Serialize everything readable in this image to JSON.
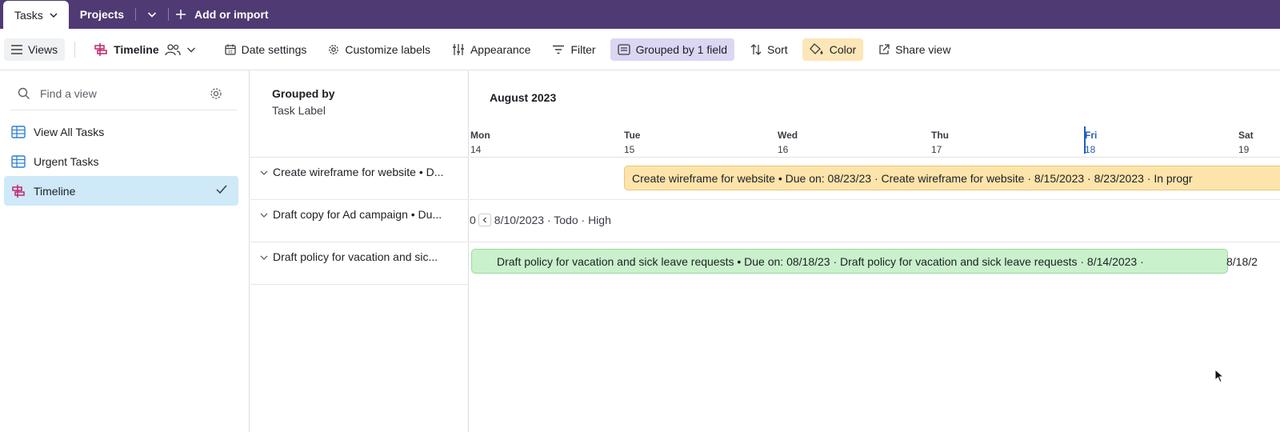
{
  "topbar": {
    "active_tab": "Tasks",
    "tab_projects": "Projects",
    "add_label": "Add or import"
  },
  "toolbar": {
    "views": "Views",
    "timeline": "Timeline",
    "date_settings": "Date settings",
    "customize_labels": "Customize labels",
    "appearance": "Appearance",
    "filter": "Filter",
    "grouped": "Grouped by 1 field",
    "sort": "Sort",
    "color": "Color",
    "share_view": "Share view"
  },
  "sidebar": {
    "search_placeholder": "Find a view",
    "items": [
      {
        "label": "View All Tasks",
        "icon": "grid-icon",
        "selected": false
      },
      {
        "label": "Urgent Tasks",
        "icon": "grid-icon",
        "selected": false
      },
      {
        "label": "Timeline",
        "icon": "timeline-icon",
        "selected": true
      }
    ]
  },
  "group_header": {
    "title": "Grouped by",
    "field": "Task Label"
  },
  "timeline": {
    "month": "August 2023",
    "days": [
      {
        "name": "Mon",
        "num": "14"
      },
      {
        "name": "Tue",
        "num": "15"
      },
      {
        "name": "Wed",
        "num": "16"
      },
      {
        "name": "Thu",
        "num": "17"
      },
      {
        "name": "Fri",
        "num": "18",
        "today": true
      },
      {
        "name": "Sat",
        "num": "19"
      }
    ]
  },
  "rows": [
    {
      "label": "Create wireframe for website • D...",
      "bar": "Create wireframe for website • Due on: 08/23/23 · Create wireframe for website · 8/15/2023 · 8/23/2023 · In progr"
    },
    {
      "label": "Draft copy for Ad campaign • Du...",
      "offscreen_edge": "0",
      "offscreen_text": "8/10/2023 · Todo · High"
    },
    {
      "label": "Draft policy for vacation and sic...",
      "bar": "Draft policy for vacation and sick leave requests • Due on: 08/18/23 · Draft policy for vacation and sick leave requests · 8/14/2023 ·",
      "bar_tail": "8/18/2"
    }
  ],
  "colors": {
    "topbar": "#4f3a73",
    "selected_view": "#cfe9f8",
    "grouped_bg": "#dcd6f3",
    "color_bg": "#fde7b8",
    "bar_orange": "#fde4aa",
    "bar_green": "#c9f1cb",
    "today": "#1f5fb8"
  }
}
